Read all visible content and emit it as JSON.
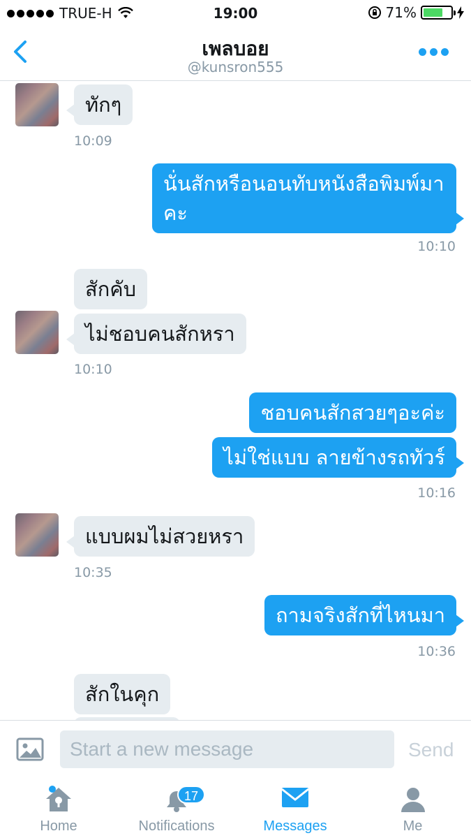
{
  "status_bar": {
    "carrier": "TRUE-H",
    "time": "19:00",
    "battery": "71%",
    "battery_level": 0.71,
    "icons": [
      "signal-dots-icon",
      "wifi-icon",
      "rotation-lock-icon",
      "battery-icon",
      "charging-icon"
    ]
  },
  "header": {
    "name": "เพลบอย",
    "handle": "@kunsron555",
    "icons": [
      "back-chevron-icon",
      "more-dots-icon"
    ]
  },
  "messages": [
    {
      "text": "ทักๆ",
      "direction": "in"
    },
    {
      "timestamp": "10:09"
    },
    {
      "text": "นั่นสักหรือนอนทับหนังสือพิมพ์มา",
      "direction": "out"
    },
    {
      "text": "คะ"
    },
    {
      "timestamp": "10:10"
    },
    {
      "text": "สักคับ",
      "direction": "in"
    },
    {
      "text": "ไม่ชอบคนสักหรา",
      "direction": "in"
    },
    {
      "timestamp": "10:10"
    },
    {
      "text": "ชอบคนสักสวยๆอะค่ะ",
      "direction": "out"
    },
    {
      "text": "ไม่ใช่แบบ ลายข้างรถทัวร์",
      "direction": "out"
    },
    {
      "timestamp": "10:16"
    },
    {
      "text": "แบบผมไม่สวยหรา",
      "direction": "in"
    },
    {
      "timestamp": "10:35"
    },
    {
      "text": "ถามจริงสักที่ไหนมา",
      "direction": "out"
    },
    {
      "timestamp": "10:36"
    },
    {
      "text": "สักในคุก",
      "direction": "in"
    }
  ],
  "composer": {
    "placeholder": "Start a new message",
    "send_label": "Send",
    "photo_icon": "photo-icon"
  },
  "tabbar": {
    "home": "Home",
    "notifications": "Notifications",
    "notifications_count": "17",
    "messages": "Messages",
    "me": "Me",
    "active": "Messages"
  },
  "colors": {
    "accent": "#1da1f2",
    "incoming_bubble": "#e6ecf0",
    "muted_text": "#8899a6",
    "battery": "#4cd964"
  }
}
